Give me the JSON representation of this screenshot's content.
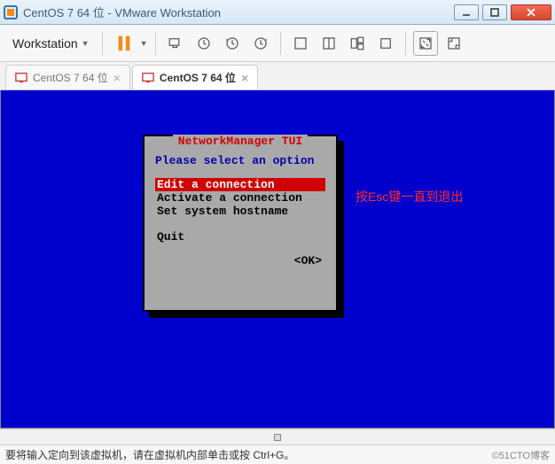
{
  "window": {
    "title": "CentOS 7 64 位 - VMware Workstation"
  },
  "toolbar": {
    "workstation_label": "Workstation"
  },
  "tabs": [
    {
      "label": "CentOS 7 64 位",
      "active": false
    },
    {
      "label": "CentOS 7 64 位",
      "active": true
    }
  ],
  "tui": {
    "title": "NetworkManager TUI",
    "prompt": "Please select an option",
    "items": [
      {
        "label": "Edit a connection",
        "selected": true
      },
      {
        "label": "Activate a connection",
        "selected": false
      },
      {
        "label": "Set system hostname",
        "selected": false
      }
    ],
    "quit": "Quit",
    "ok": "<OK>"
  },
  "annotation": "按Esc键一直到退出",
  "statusbar": {
    "hint": "要将输入定向到该虚拟机，请在虚拟机内部单击或按 Ctrl+G。",
    "watermark": "©51CTO博客"
  }
}
